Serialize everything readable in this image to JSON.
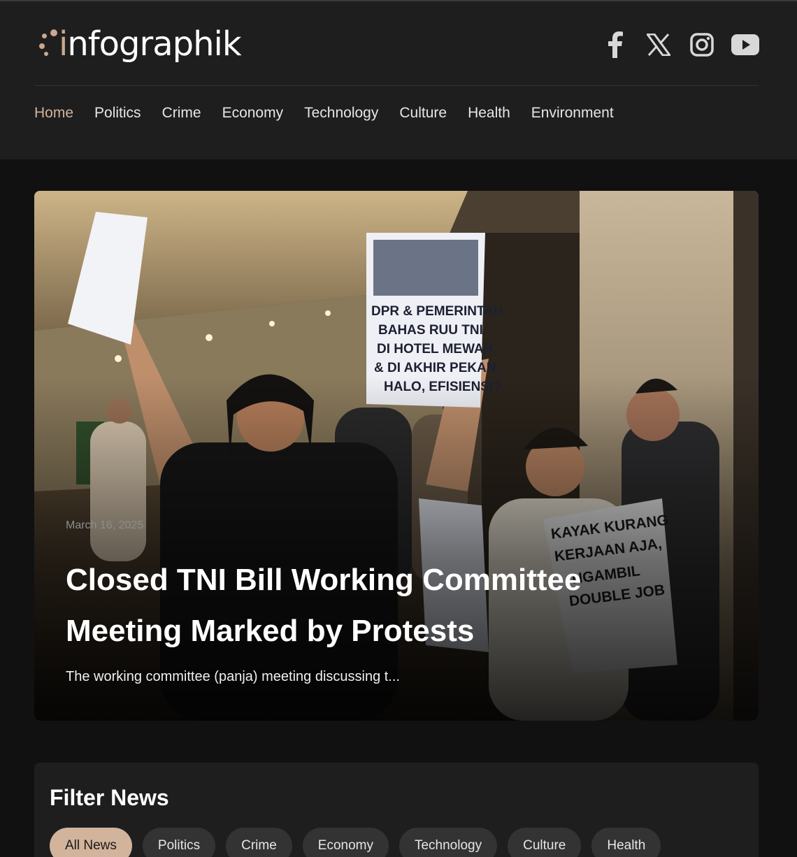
{
  "brand": {
    "logo_prefix": "i",
    "logo_rest": "nfographik",
    "accent_color": "#c9a88f"
  },
  "social": [
    {
      "icon": "facebook-icon"
    },
    {
      "icon": "x-icon"
    },
    {
      "icon": "instagram-icon"
    },
    {
      "icon": "youtube-icon"
    }
  ],
  "nav": {
    "items": [
      "Home",
      "Politics",
      "Crime",
      "Economy",
      "Technology",
      "Culture",
      "Health",
      "Environment"
    ],
    "active": "Home",
    "active_color": "#d2b39b"
  },
  "hero": {
    "date": "March 16, 2025",
    "title": "Closed TNI Bill Working Committee Meeting Marked by Protests",
    "excerpt": "The working committee (panja) meeting discussing t...",
    "image_description_icon": "hero-photo"
  },
  "filter": {
    "title": "Filter News",
    "chips": [
      "All News",
      "Politics",
      "Crime",
      "Economy",
      "Technology",
      "Culture",
      "Health"
    ],
    "active": "All News"
  }
}
